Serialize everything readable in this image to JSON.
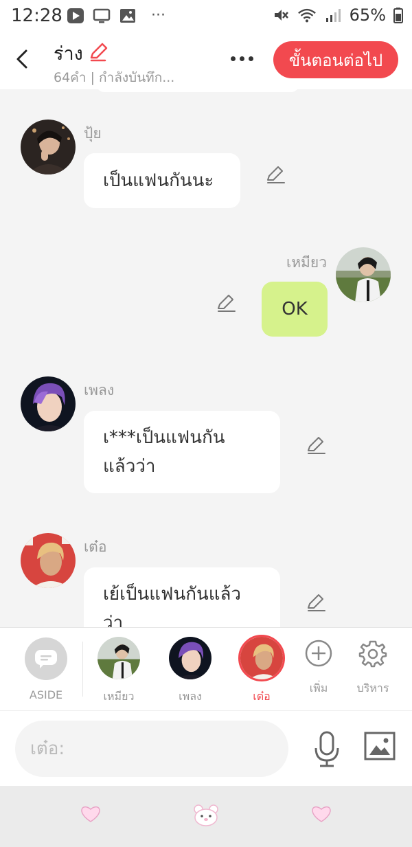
{
  "status_bar": {
    "time": "12:28",
    "ellipsis": "···",
    "battery_text": "65%"
  },
  "header": {
    "title": "ร่าง",
    "subtitle": "64คำ | กำลังบันทึก...",
    "next_button_label": "ขั้นตอนต่อไป"
  },
  "messages": [
    {
      "speaker": "ปุ้ย",
      "side": "left",
      "text": "เป็นแฟนกันนะ"
    },
    {
      "speaker": "เหมียว",
      "side": "right",
      "text": "OK"
    },
    {
      "speaker": "เพลง",
      "side": "left",
      "lines": [
        "เ***เป็นแฟนกัน",
        "แล้วว่า"
      ]
    },
    {
      "speaker": "เต๋อ",
      "side": "left",
      "lines": [
        "เย้เป็นแฟนกันแล้ว",
        "ว่า"
      ]
    }
  ],
  "character_bar": {
    "aside_label": "ASIDE",
    "characters": [
      {
        "label": "เหมียว",
        "active": false
      },
      {
        "label": "เพลง",
        "active": false
      },
      {
        "label": "เต๋อ",
        "active": true
      }
    ],
    "add_label": "เพิ่ม",
    "manage_label": "บริหาร"
  },
  "input": {
    "placeholder": "เต๋อ:"
  },
  "colors": {
    "accent": "#f2494f",
    "my_bubble": "#d6f28c",
    "chat_background": "#f4f4f4"
  }
}
